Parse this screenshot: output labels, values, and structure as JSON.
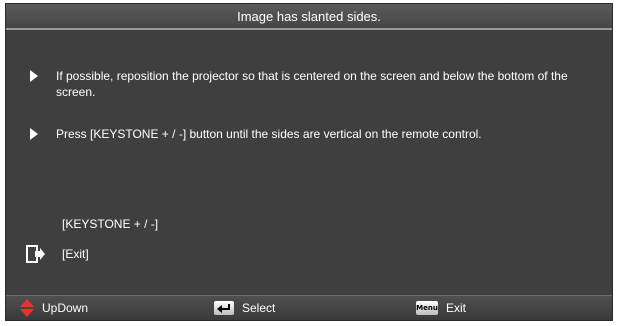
{
  "title": "Image has slanted sides.",
  "instructions": [
    {
      "text": "If possible, reposition the projector so that is centered on the screen and below the bottom of the screen."
    },
    {
      "text": "Press [KEYSTONE + / -] button until the sides are vertical on the remote control."
    }
  ],
  "options": {
    "keystone_label": "[KEYSTONE + / -]",
    "exit_label": "[Exit]"
  },
  "footer": {
    "updown_label": "UpDown",
    "select_label": "Select",
    "menu_key_text": "Menu",
    "exit_label": "Exit"
  },
  "icons": {
    "bullet": "arrow-right-icon",
    "exit": "exit-door-icon",
    "updown": "up-down-arrows-icon",
    "select": "enter-key-icon",
    "menu": "menu-key-icon"
  },
  "colors": {
    "panel_bg": "#404040",
    "text": "#ffffff",
    "updown_icon": "#e8342e"
  }
}
